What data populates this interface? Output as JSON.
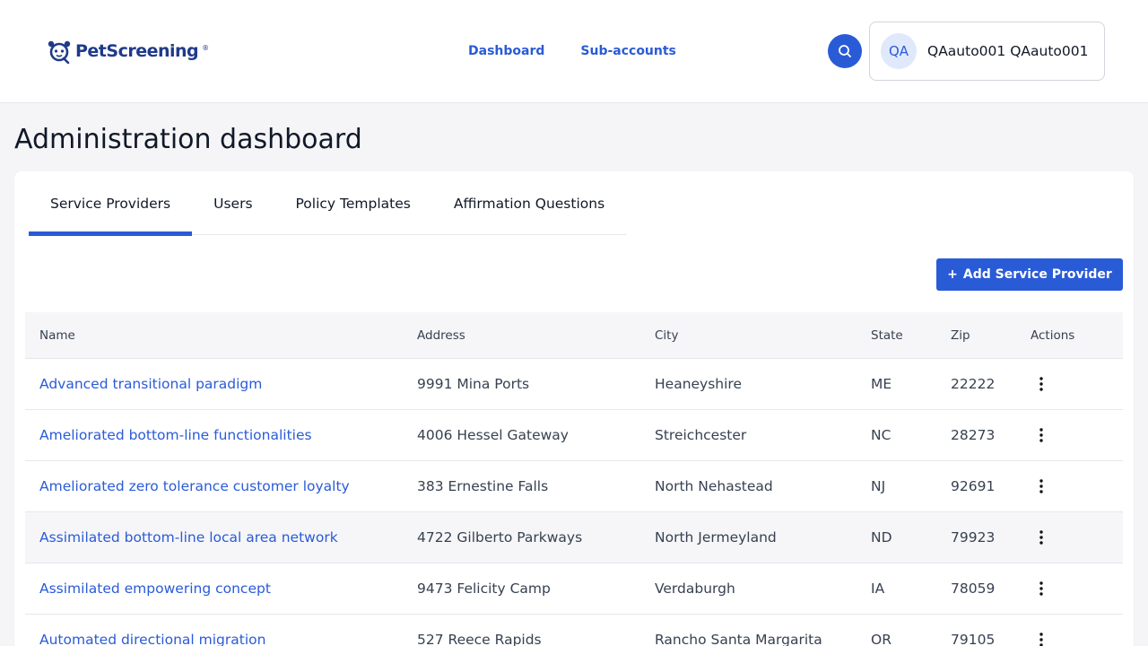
{
  "header": {
    "logo_text": "PetScreening",
    "logo_reg": "®",
    "nav": [
      "Dashboard",
      "Sub-accounts"
    ],
    "user": {
      "initials": "QA",
      "name": "QAauto001 QAauto001"
    }
  },
  "page": {
    "title": "Administration dashboard"
  },
  "tabs": [
    "Service Providers",
    "Users",
    "Policy Templates",
    "Affirmation Questions"
  ],
  "active_tab": "Service Providers",
  "actions": {
    "add_label": "Add Service Provider",
    "add_icon": "+"
  },
  "table": {
    "columns": [
      "Name",
      "Address",
      "City",
      "State",
      "Zip",
      "Actions"
    ],
    "rows": [
      {
        "name": "Advanced transitional paradigm",
        "address": "9991 Mina Ports",
        "city": "Heaneyshire",
        "state": "ME",
        "zip": "22222"
      },
      {
        "name": "Ameliorated bottom-line functionalities",
        "address": "4006 Hessel Gateway",
        "city": "Streichcester",
        "state": "NC",
        "zip": "28273"
      },
      {
        "name": "Ameliorated zero tolerance customer loyalty",
        "address": "383 Ernestine Falls",
        "city": "North Nehastead",
        "state": "NJ",
        "zip": "92691"
      },
      {
        "name": "Assimilated bottom-line local area network",
        "address": "4722 Gilberto Parkways",
        "city": "North Jermeyland",
        "state": "ND",
        "zip": "79923"
      },
      {
        "name": "Assimilated empowering concept",
        "address": "9473 Felicity Camp",
        "city": "Verdaburgh",
        "state": "IA",
        "zip": "78059"
      },
      {
        "name": "Automated directional migration",
        "address": "527 Reece Rapids",
        "city": "Rancho Santa Margarita",
        "state": "OR",
        "zip": "79105"
      }
    ]
  },
  "colors": {
    "accent": "#2a5bd7",
    "brand": "#1e3a8a",
    "background": "#f5f5f7"
  }
}
